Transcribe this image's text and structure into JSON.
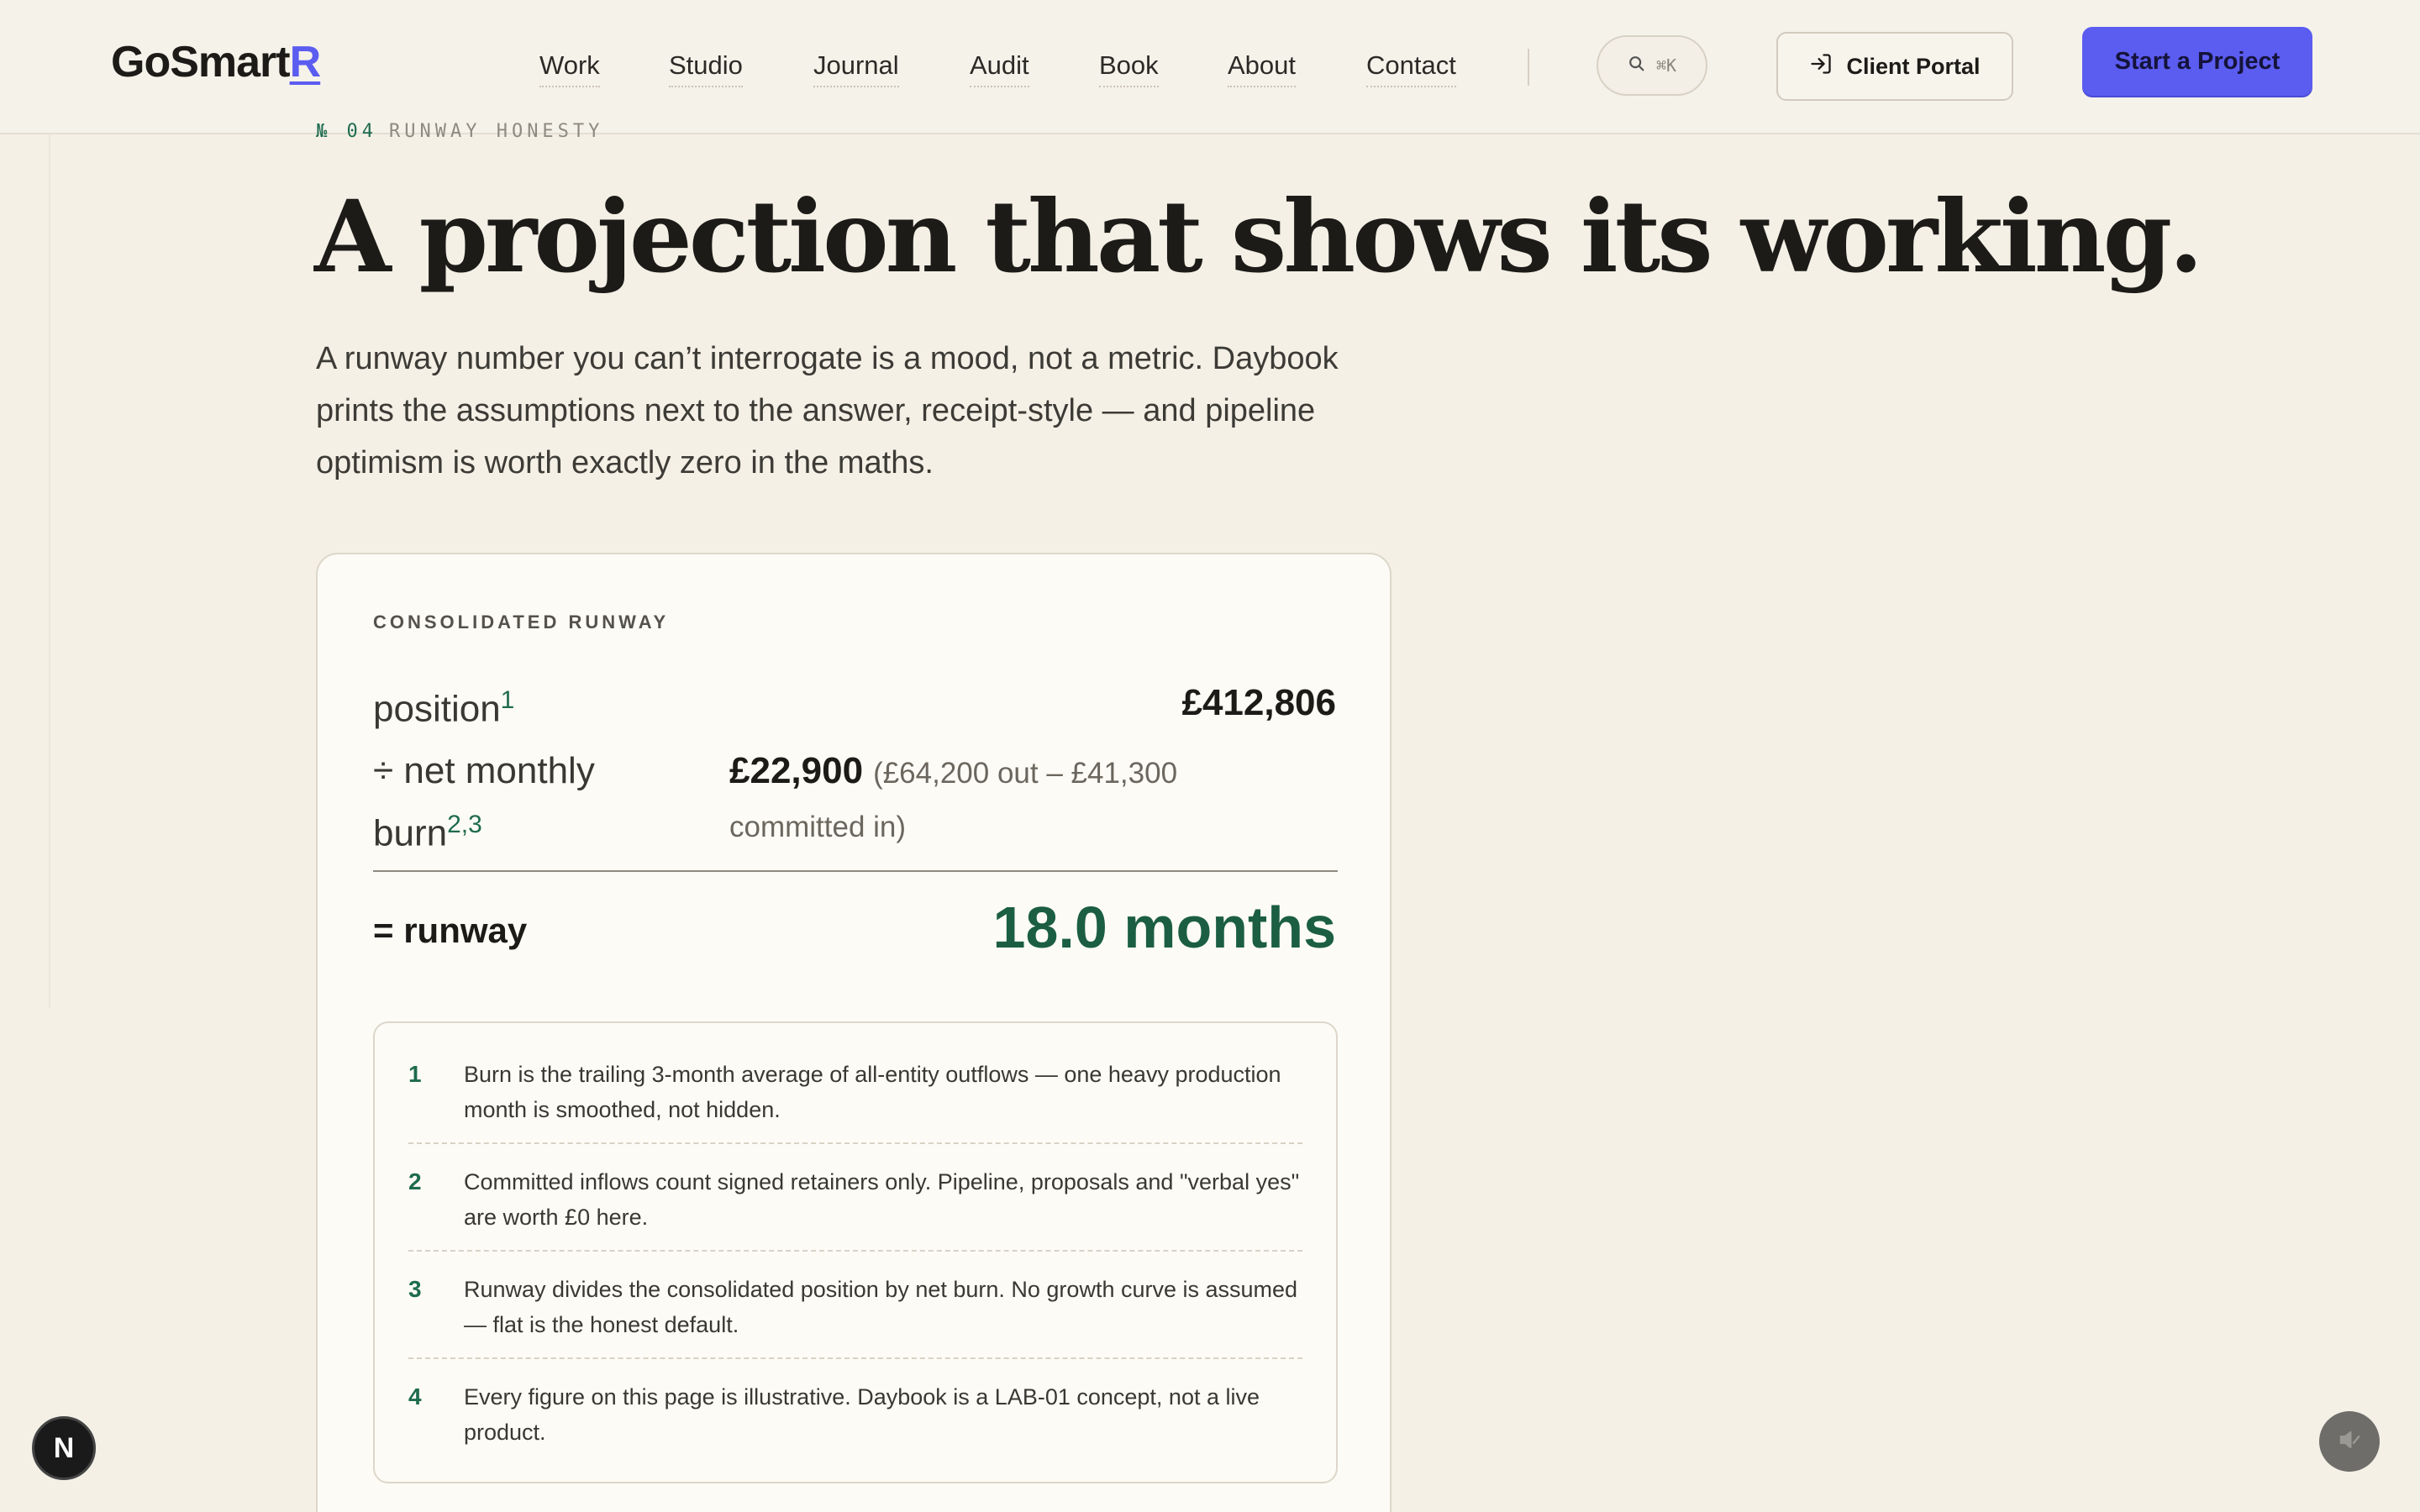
{
  "scroll_progress": 0.377,
  "header": {
    "logo_main": "GoSmart",
    "logo_accent": "R",
    "nav": [
      "Work",
      "Studio",
      "Journal",
      "Audit",
      "Book",
      "About",
      "Contact"
    ],
    "search_shortcut": "⌘K",
    "client_portal": "Client Portal",
    "cta": "Start a Project"
  },
  "section": {
    "number": "№ 04",
    "eyebrow": "RUNWAY HONESTY",
    "headline": "A projection that shows its working.",
    "lede": "A runway number you can’t interrogate is a mood, not a metric. Daybook prints the assumptions next to the answer, receipt-style — and pipeline optimism is worth exactly zero in the maths."
  },
  "card": {
    "label": "CONSOLIDATED RUNWAY",
    "position_label": "position",
    "position_sup": "1",
    "position_value": "£412,806",
    "burn_label": "÷ net monthly burn",
    "burn_sup": "2,3",
    "burn_value": "£22,900",
    "burn_detail": "(£64,200 out – £41,300 committed in)",
    "total_label": "= runway",
    "total_value": "18.0 months",
    "notes": [
      {
        "num": "1",
        "text": "Burn is the trailing 3-month average of all-entity outflows — one heavy production month is smoothed, not hidden."
      },
      {
        "num": "2",
        "text": "Committed inflows count signed retainers only. Pipeline, proposals and \"verbal yes\" are worth £0 here."
      },
      {
        "num": "3",
        "text": "Runway divides the consolidated position by net burn. No growth curve is assumed — flat is the honest default."
      },
      {
        "num": "4",
        "text": "Every figure on this page is illustrative. Daybook is a LAB-01 concept, not a live product."
      }
    ]
  },
  "floating": {
    "badge": "N"
  },
  "colors": {
    "accent": "#5b5cf0",
    "green": "#1b5e43",
    "background": "#f4f0e6"
  }
}
